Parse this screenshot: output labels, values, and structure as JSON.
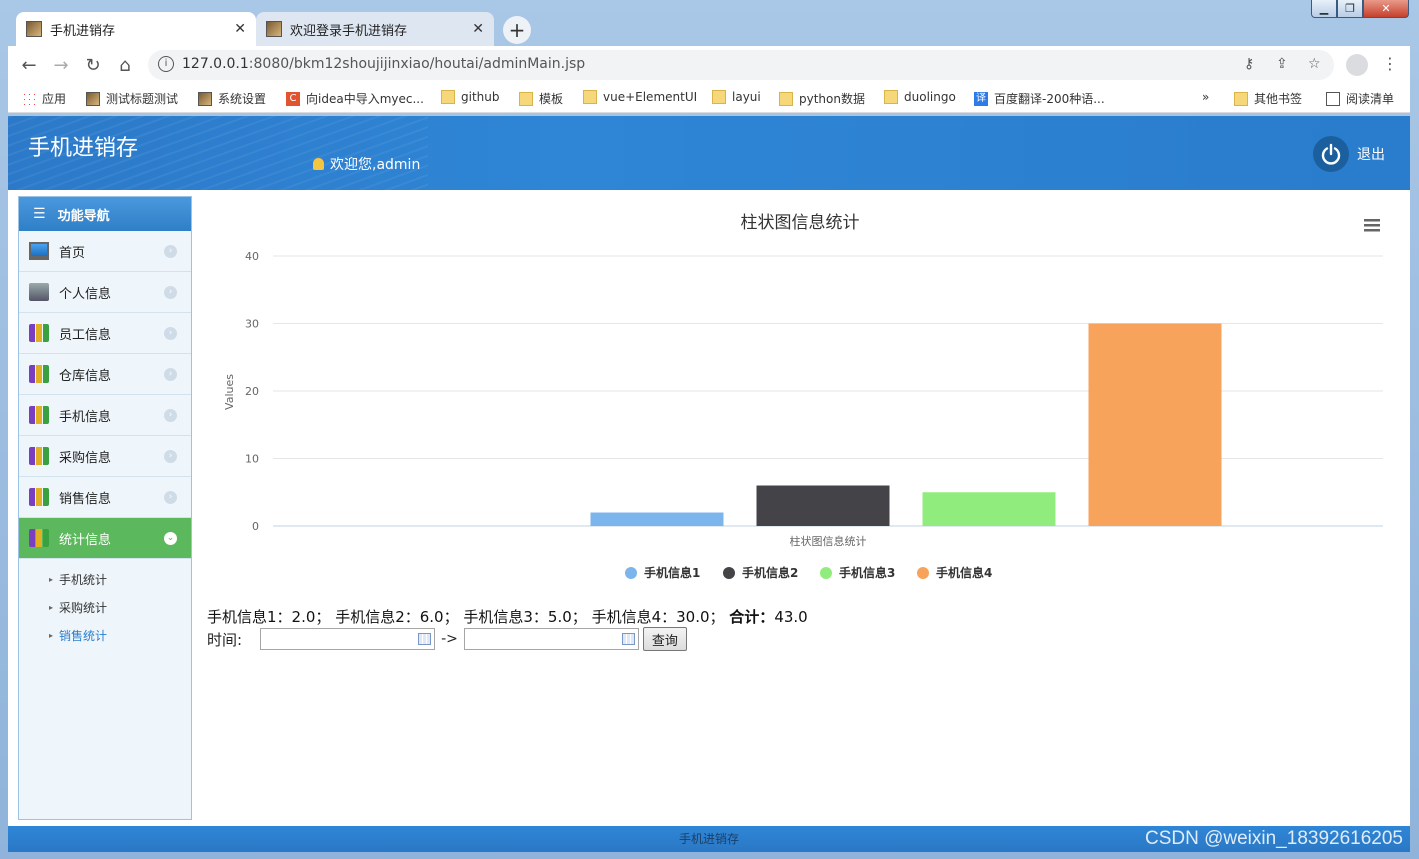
{
  "browser": {
    "tabs": [
      {
        "title": "手机进销存",
        "active": true
      },
      {
        "title": "欢迎登录手机进销存",
        "active": false
      }
    ],
    "url_host": "127.0.0.1",
    "url_rest": ":8080/bkm12shoujijinxiao/houtai/adminMain.jsp",
    "bookmarks": [
      {
        "label": "应用",
        "icon": "apps-icon"
      },
      {
        "label": "测试标题测试",
        "icon": "image-icon"
      },
      {
        "label": "系统设置",
        "icon": "image-icon"
      },
      {
        "label": "向idea中导入myec...",
        "icon": "c-icon"
      },
      {
        "label": "github",
        "icon": "folder-icon"
      },
      {
        "label": "模板",
        "icon": "folder-icon"
      },
      {
        "label": "vue+ElementUI",
        "icon": "folder-icon"
      },
      {
        "label": "layui",
        "icon": "folder-icon"
      },
      {
        "label": "python数据",
        "icon": "folder-icon"
      },
      {
        "label": "duolingo",
        "icon": "folder-icon"
      },
      {
        "label": "百度翻译-200种语...",
        "icon": "translate-icon"
      }
    ],
    "more": "»",
    "other_bookmarks": "其他书签",
    "reading_list": "阅读清单"
  },
  "app": {
    "title": "手机进销存",
    "welcome": "欢迎您,admin",
    "logout": "退出",
    "footer": "手机进销存"
  },
  "sidebar": {
    "header": "功能导航",
    "items": [
      {
        "label": "首页",
        "icon": "monitor-icon"
      },
      {
        "label": "个人信息",
        "icon": "printer-icon"
      },
      {
        "label": "员工信息",
        "icon": "bottles-icon"
      },
      {
        "label": "仓库信息",
        "icon": "bottles-icon"
      },
      {
        "label": "手机信息",
        "icon": "bottles-icon"
      },
      {
        "label": "采购信息",
        "icon": "bottles-icon"
      },
      {
        "label": "销售信息",
        "icon": "bottles-icon"
      },
      {
        "label": "统计信息",
        "icon": "bottles-icon",
        "active": true
      }
    ],
    "subitems": [
      {
        "label": "手机统计"
      },
      {
        "label": "采购统计"
      },
      {
        "label": "销售统计",
        "active": true
      }
    ]
  },
  "chart_data": {
    "type": "bar",
    "title": "柱状图信息统计",
    "xlabel": "柱状图信息统计",
    "ylabel": "Values",
    "ylim": [
      0,
      40
    ],
    "yticks": [
      0,
      10,
      20,
      30,
      40
    ],
    "legend_position": "bottom",
    "series": [
      {
        "name": "手机信息1",
        "values": [
          2.0
        ],
        "color": "#7cb5ec"
      },
      {
        "name": "手机信息2",
        "values": [
          6.0
        ],
        "color": "#434348"
      },
      {
        "name": "手机信息3",
        "values": [
          5.0
        ],
        "color": "#90ed7d"
      },
      {
        "name": "手机信息4",
        "values": [
          30.0
        ],
        "color": "#f7a35c"
      }
    ]
  },
  "summary": {
    "s1": "手机信息1：2.0；",
    "s2": "手机信息2：6.0；",
    "s3": "手机信息3：5.0；",
    "s4": "手机信息4：30.0；",
    "total_label": "合计：",
    "total_value": "43.0"
  },
  "query": {
    "time_label": "时间:",
    "arrow": "->",
    "start_value": "",
    "end_value": "",
    "button": "查询"
  },
  "watermark": "CSDN @weixin_18392616205"
}
